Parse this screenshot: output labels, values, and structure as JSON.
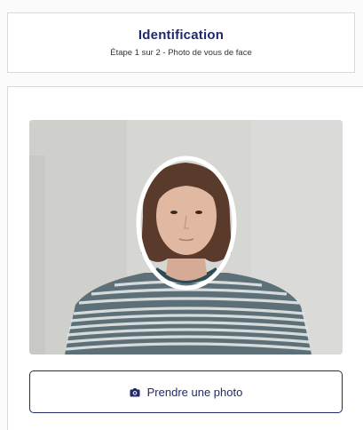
{
  "header": {
    "title": "Identification",
    "subtitle": "Étape 1 sur 2 - Photo de vous de face"
  },
  "camera": {
    "overlay": "face-oval-guide"
  },
  "capture": {
    "label": "Prendre une photo",
    "icon": "camera-icon"
  },
  "colors": {
    "brand": "#1f2a6b",
    "border": "#d9d9d9"
  }
}
